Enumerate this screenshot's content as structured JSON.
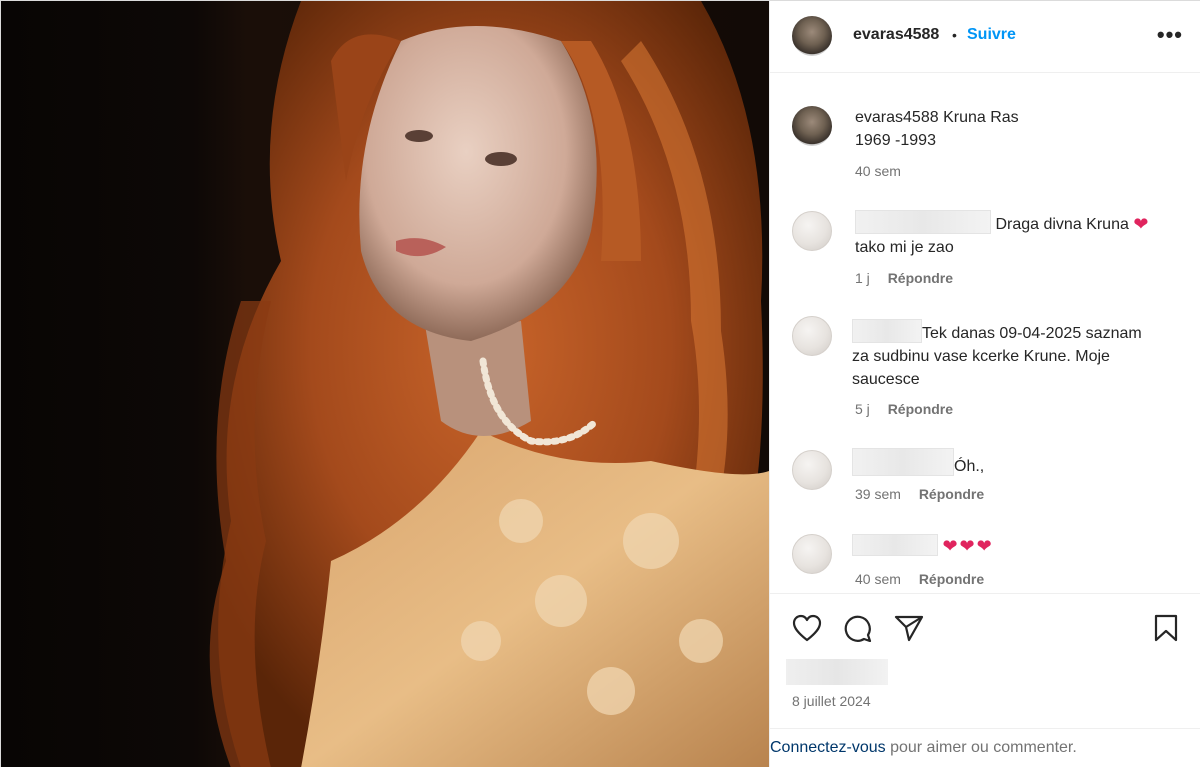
{
  "post": {
    "author": "evaras4588",
    "separator": "•",
    "follow_label": "Suivre",
    "more_label": "•••",
    "date": "8 juillet 2024"
  },
  "caption": {
    "username": "evaras4588",
    "text_line1": "Kruna Ras",
    "text_line2": "1969 -1993",
    "time": "40 sem"
  },
  "comments": [
    {
      "text_line1": "Draga divna Kruna",
      "emoji": "❤",
      "text_line2": "tako mi je zao",
      "time": "1 j",
      "reply_label": "Répondre"
    },
    {
      "text_line1": "Tek danas 09-04-2025 saznam",
      "text_line2": "za sudbinu vase kcerke Krune. Moje",
      "text_line3": "saucesce",
      "time": "5 j",
      "reply_label": "Répondre"
    },
    {
      "text": "Óh.,",
      "time": "39 sem",
      "reply_label": "Répondre"
    },
    {
      "emoji": "❤❤❤",
      "time": "40 sem",
      "reply_label": "Répondre"
    }
  ],
  "actions": {
    "icons": [
      "heart-icon",
      "comment-icon",
      "share-icon",
      "bookmark-icon"
    ]
  },
  "login_prompt": {
    "link": "Connectez-vous",
    "text": " pour aimer ou commenter."
  },
  "colors": {
    "follow": "#0095f6",
    "muted": "#737373",
    "heart": "#e0245e",
    "link": "#00376b"
  }
}
